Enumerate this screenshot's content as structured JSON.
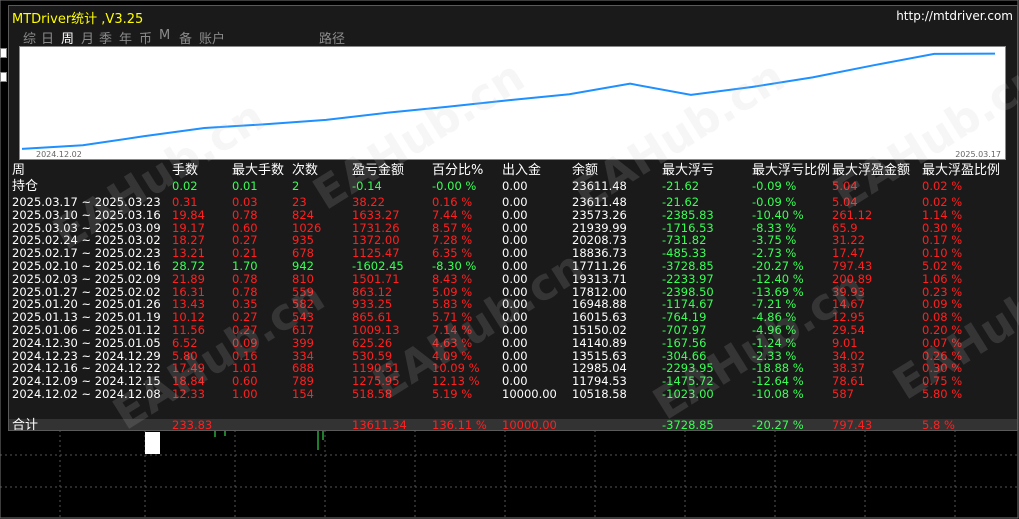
{
  "window": {
    "title": "MTDriver统计 ,V3.25",
    "url": "http://mtdriver.com"
  },
  "tabs": [
    {
      "label": "综",
      "active": false
    },
    {
      "label": "日",
      "active": false
    },
    {
      "label": "周",
      "active": true
    },
    {
      "label": "月",
      "active": false
    },
    {
      "label": "季",
      "active": false
    },
    {
      "label": "年",
      "active": false
    },
    {
      "label": "币",
      "active": false
    },
    {
      "label": "M",
      "active": false
    },
    {
      "label": "备",
      "active": false
    },
    {
      "label": "账户",
      "active": false
    },
    {
      "label": "路径",
      "active": false
    }
  ],
  "equity_curve": {
    "start_label": "2024.12.02",
    "end_label": "2025.03.17",
    "line_color": "#1e90ff",
    "x": [
      "2024.12.02",
      "2024.12.09",
      "2024.12.16",
      "2024.12.23",
      "2024.12.30",
      "2025.01.06",
      "2025.01.13",
      "2025.01.20",
      "2025.01.27",
      "2025.02.03",
      "2025.02.10",
      "2025.02.17",
      "2025.02.24",
      "2025.03.03",
      "2025.03.10",
      "2025.03.17"
    ],
    "balance": [
      10000.0,
      10518.58,
      11794.53,
      12985.04,
      13515.63,
      14140.89,
      15150.02,
      16015.63,
      16948.88,
      17812.0,
      19313.71,
      17711.26,
      18836.73,
      20208.73,
      21939.99,
      23573.26,
      23611.48
    ]
  },
  "table": {
    "headers": [
      "周",
      "手数",
      "最大手数",
      "次数",
      "盈亏金额",
      "百分比%",
      "出入金",
      "余额",
      "最大浮亏",
      "最大浮亏比例",
      "最大浮盈金额",
      "最大浮盈比例"
    ],
    "open_row": {
      "label": "持仓",
      "cells": [
        "0.02",
        "0.01",
        "2",
        "-0.14",
        "-0.00 %",
        "0.00",
        "23611.48",
        "-21.62",
        "-0.09 %",
        "5.04",
        "0.02 %"
      ],
      "colors": [
        "g",
        "g",
        "g",
        "g",
        "g",
        "w",
        "w",
        "g",
        "g",
        "r",
        "r"
      ]
    },
    "rows": [
      {
        "period": "2025.03.17 ~ 2025.03.23",
        "cells": [
          "0.31",
          "0.03",
          "23",
          "38.22",
          "0.16 %",
          "0.00",
          "23611.48",
          "-21.62",
          "-0.09 %",
          "5.04",
          "0.02 %"
        ],
        "color": "r"
      },
      {
        "period": "2025.03.10 ~ 2025.03.16",
        "cells": [
          "19.84",
          "0.78",
          "824",
          "1633.27",
          "7.44 %",
          "0.00",
          "23573.26",
          "-2385.83",
          "-10.40 %",
          "261.12",
          "1.14 %"
        ],
        "color": "r"
      },
      {
        "period": "2025.03.03 ~ 2025.03.09",
        "cells": [
          "19.17",
          "0.60",
          "1026",
          "1731.26",
          "8.57 %",
          "0.00",
          "21939.99",
          "-1716.53",
          "-8.33 %",
          "65.9",
          "0.30 %"
        ],
        "color": "r"
      },
      {
        "period": "2025.02.24 ~ 2025.03.02",
        "cells": [
          "18.27",
          "0.27",
          "935",
          "1372.00",
          "7.28 %",
          "0.00",
          "20208.73",
          "-731.82",
          "-3.75 %",
          "31.22",
          "0.17 %"
        ],
        "color": "r"
      },
      {
        "period": "2025.02.17 ~ 2025.02.23",
        "cells": [
          "13.21",
          "0.21",
          "678",
          "1125.47",
          "6.35 %",
          "0.00",
          "18836.73",
          "-485.33",
          "-2.73 %",
          "17.47",
          "0.10 %"
        ],
        "color": "r"
      },
      {
        "period": "2025.02.10 ~ 2025.02.16",
        "cells": [
          "28.72",
          "1.70",
          "942",
          "-1602.45",
          "-8.30 %",
          "0.00",
          "17711.26",
          "-3728.85",
          "-20.27 %",
          "797.43",
          "5.02 %"
        ],
        "color": "g"
      },
      {
        "period": "2025.02.03 ~ 2025.02.09",
        "cells": [
          "21.89",
          "0.78",
          "810",
          "1501.71",
          "8.43 %",
          "0.00",
          "19313.71",
          "-2233.97",
          "-12.40 %",
          "200.89",
          "1.06 %"
        ],
        "color": "r"
      },
      {
        "period": "2025.01.27 ~ 2025.02.02",
        "cells": [
          "16.31",
          "0.78",
          "559",
          "863.12",
          "5.09 %",
          "0.00",
          "17812.00",
          "-2398.50",
          "-13.69 %",
          "39.93",
          "0.23 %"
        ],
        "color": "r"
      },
      {
        "period": "2025.01.20 ~ 2025.01.26",
        "cells": [
          "13.43",
          "0.35",
          "582",
          "933.25",
          "5.83 %",
          "0.00",
          "16948.88",
          "-1174.67",
          "-7.21 %",
          "14.67",
          "0.09 %"
        ],
        "color": "r"
      },
      {
        "period": "2025.01.13 ~ 2025.01.19",
        "cells": [
          "10.12",
          "0.27",
          "543",
          "865.61",
          "5.71 %",
          "0.00",
          "16015.63",
          "-764.19",
          "-4.86 %",
          "12.95",
          "0.08 %"
        ],
        "color": "r"
      },
      {
        "period": "2025.01.06 ~ 2025.01.12",
        "cells": [
          "11.56",
          "0.27",
          "617",
          "1009.13",
          "7.14 %",
          "0.00",
          "15150.02",
          "-707.97",
          "-4.96 %",
          "29.54",
          "0.20 %"
        ],
        "color": "r"
      },
      {
        "period": "2024.12.30 ~ 2025.01.05",
        "cells": [
          "6.52",
          "0.09",
          "399",
          "625.26",
          "4.63 %",
          "0.00",
          "14140.89",
          "-167.56",
          "-1.24 %",
          "9.01",
          "0.07 %"
        ],
        "color": "r"
      },
      {
        "period": "2024.12.23 ~ 2024.12.29",
        "cells": [
          "5.80",
          "0.16",
          "334",
          "530.59",
          "4.09 %",
          "0.00",
          "13515.63",
          "-304.66",
          "-2.33 %",
          "34.02",
          "0.26 %"
        ],
        "color": "r"
      },
      {
        "period": "2024.12.16 ~ 2024.12.22",
        "cells": [
          "17.49",
          "1.01",
          "688",
          "1190.51",
          "10.09 %",
          "0.00",
          "12985.04",
          "-2293.95",
          "-18.88 %",
          "38.37",
          "0.30 %"
        ],
        "color": "r"
      },
      {
        "period": "2024.12.09 ~ 2024.12.15",
        "cells": [
          "18.84",
          "0.60",
          "789",
          "1275.95",
          "12.13 %",
          "0.00",
          "11794.53",
          "-1475.72",
          "-12.64 %",
          "78.61",
          "0.75 %"
        ],
        "color": "r"
      },
      {
        "period": "2024.12.02 ~ 2024.12.08",
        "cells": [
          "12.33",
          "1.00",
          "154",
          "518.58",
          "5.19 %",
          "10000.00",
          "10518.58",
          "-1023.00",
          "-10.08 %",
          "587",
          "5.80 %"
        ],
        "color": "r"
      }
    ],
    "total_row": {
      "label": "合计",
      "cells": [
        "233.83",
        "",
        "",
        "13611.34",
        "136.11 %",
        "10000.00",
        "",
        "-3728.85",
        "-20.27 %",
        "797.43",
        "5.8 %"
      ],
      "colors": [
        "r",
        "r",
        "r",
        "r",
        "r",
        "r",
        "w",
        "g",
        "g",
        "r",
        "r"
      ]
    }
  },
  "watermark": {
    "text": "EAHub.cn"
  }
}
